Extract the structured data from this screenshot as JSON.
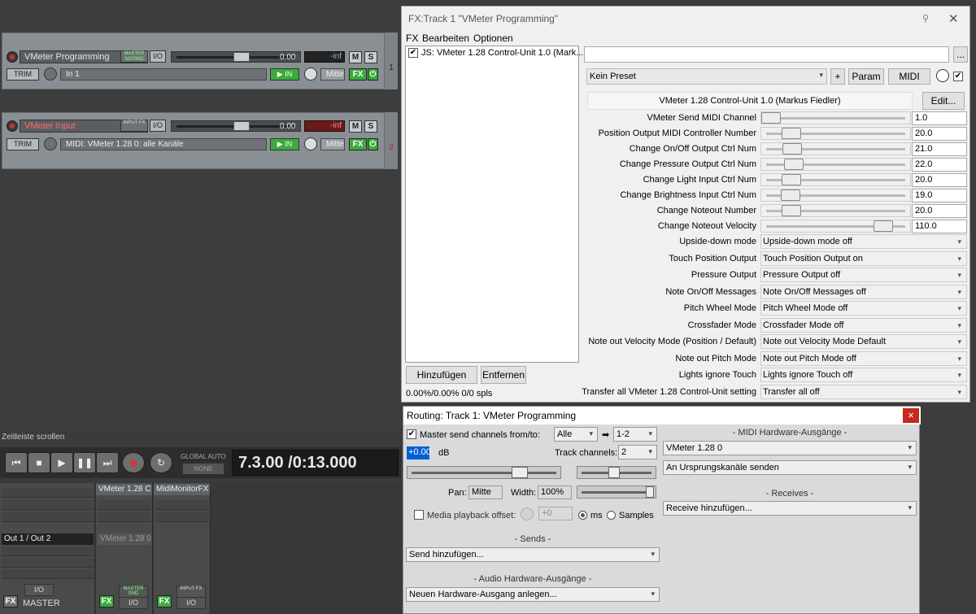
{
  "tracks": [
    {
      "name": "VMeter Programming",
      "route_badge": "MASTER NO/SND",
      "io": "I/O",
      "vol": "0.00",
      "peak": "-inf",
      "mute": "M",
      "solo": "S",
      "trim": "TRIM",
      "input": "In 1",
      "pan": "Mitte",
      "fx": "FX",
      "number": "1",
      "name_color": "#e6e6e6"
    },
    {
      "name": "VMeter Input",
      "route_badge": "INPUT FX",
      "io": "I/O",
      "vol": "0.00",
      "peak": "-inf",
      "mute": "M",
      "solo": "S",
      "trim": "TRIM",
      "input": "MIDI: VMeter 1.28 0: alle Kanäle",
      "pan": "Mitte",
      "fx": "FX",
      "number": "2",
      "name_color": "#ff6060"
    }
  ],
  "timeline_label": "Zeitleiste scrollen",
  "transport": {
    "global_auto": "GLOBAL AUTO",
    "none": "NONE",
    "time": "7.3.00 /0:13.000"
  },
  "mixer": {
    "master_out": "Out 1 / Out 2",
    "master_label": "MASTER",
    "master_io": "I/O",
    "fx": "FX",
    "strips": [
      {
        "name": "VMeter 1.28 C",
        "slot": "VMeter 1.28 0",
        "badge": "MASTER SND",
        "io": "I/O"
      },
      {
        "name": "MidiMonitorFX",
        "badge": "INPUT FX",
        "io": "I/O"
      }
    ]
  },
  "fxwin": {
    "title": "FX:Track 1 \"VMeter Programming\"",
    "menu": [
      "FX",
      "Bearbeiten",
      "Optionen"
    ],
    "plugin": "JS: VMeter 1.28 Control-Unit 1.0 (Mark...",
    "add": "Hinzufügen",
    "remove": "Entfernen",
    "cpu": "0.00%/0.00% 0/0 spls",
    "dots": "...",
    "preset": "Kein Preset",
    "plus": "+",
    "param": "Param",
    "midi": "MIDI",
    "header": "VMeter 1.28 Control-Unit 1.0 (Markus Fiedler)",
    "edit": "Edit...",
    "sliders": [
      {
        "label": "VMeter Send MIDI Channel",
        "value": "1.0",
        "pos": 0.0
      },
      {
        "label": "Position Output MIDI Controller Number",
        "value": "20.0",
        "pos": 0.157
      },
      {
        "label": "Change On/Off Output Ctrl Num",
        "value": "21.0",
        "pos": 0.165
      },
      {
        "label": "Change Pressure Output Ctrl Num",
        "value": "22.0",
        "pos": 0.173
      },
      {
        "label": "Change Light Input Ctrl Num",
        "value": "20.0",
        "pos": 0.157
      },
      {
        "label": "Change Brightness Input Ctrl Num",
        "value": "19.0",
        "pos": 0.15
      },
      {
        "label": "Change Noteout Number",
        "value": "20.0",
        "pos": 0.157
      },
      {
        "label": "Change Noteout Velocity",
        "value": "110.0",
        "pos": 0.866
      }
    ],
    "combos": [
      {
        "label": "Upside-down mode",
        "value": "Upside-down mode off"
      },
      {
        "label": "Touch Position Output",
        "value": "Touch Position Output on"
      },
      {
        "label": "Pressure Output",
        "value": "Pressure Output off"
      },
      {
        "label": "Note On/Off Messages",
        "value": "Note On/Off Messages off"
      },
      {
        "label": "Pitch Wheel Mode",
        "value": "Pitch Wheel Mode off"
      },
      {
        "label": "Crossfader Mode",
        "value": "Crossfader Mode off"
      },
      {
        "label": "Note out Velocity Mode (Position / Default)",
        "value": "Note out Velocity Mode Default"
      },
      {
        "label": "Note out Pitch Mode",
        "value": "Note out Pitch Mode off"
      },
      {
        "label": "Lights ignore Touch",
        "value": "Lights ignore Touch off"
      },
      {
        "label": "Transfer all VMeter 1.28 Control-Unit setting",
        "value": "Transfer all off"
      }
    ]
  },
  "routing": {
    "title": "Routing: Track 1: VMeter Programming",
    "close": "×",
    "master_send": "Master send channels from/to:",
    "from": "Alle",
    "arrow": "➡",
    "to": "1-2",
    "vol": "+0.00",
    "db": "dB",
    "track_channels_label": "Track channels:",
    "track_channels": "2",
    "pan_label": "Pan:",
    "pan": "Mitte",
    "width_label": "Width:",
    "width": "100%",
    "media_offset": "Media playback offset:",
    "offset_value": "+0",
    "ms": "ms",
    "samples": "Samples",
    "sends_header": "- Sends -",
    "send_add": "Send hinzufügen...",
    "audio_hw_header": "- Audio Hardware-Ausgänge -",
    "audio_hw_add": "Neuen Hardware-Ausgang anlegen...",
    "midi_hw_header": "- MIDI Hardware-Ausgänge -",
    "midi_device": "VMeter 1.28 0",
    "midi_mode": "An Ursprungskanäle senden",
    "receives_header": "- Receives -",
    "receive_add": "Receive hinzufügen..."
  }
}
